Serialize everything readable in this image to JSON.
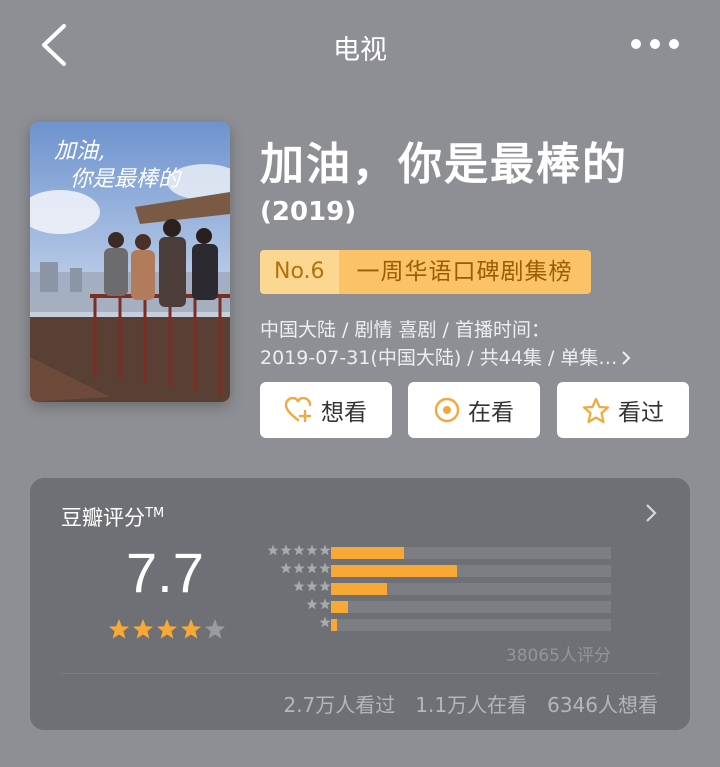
{
  "nav": {
    "title": "电视",
    "back_icon": "chevron-left-icon",
    "more_icon": "more-dots-icon"
  },
  "movie": {
    "title": "加油，你是最棒的",
    "year": "(2019)",
    "poster_title_art": "加油，你是最棒的",
    "rank": {
      "number": "No.6",
      "name": "一周华语口碑剧集榜"
    },
    "meta_line1": "中国大陆 / 剧情 喜剧 / 首播时间：",
    "meta_line2": "2019-07-31(中国大陆) / 共44集 / 单集…"
  },
  "actions": [
    {
      "label": "想看",
      "icon": "heart-plus-icon"
    },
    {
      "label": "在看",
      "icon": "circle-dot-icon"
    },
    {
      "label": "看过",
      "icon": "star-outline-icon"
    }
  ],
  "rating": {
    "title": "豆瓣评分",
    "trademark": "TM",
    "score": "7.7",
    "stars": 4,
    "distribution": [
      {
        "stars": 5,
        "fraction": 0.26
      },
      {
        "stars": 4,
        "fraction": 0.45
      },
      {
        "stars": 3,
        "fraction": 0.2
      },
      {
        "stars": 2,
        "fraction": 0.06
      },
      {
        "stars": 1,
        "fraction": 0.02
      }
    ],
    "count": "38065人评分",
    "watched": "2.7万人看过",
    "watching": "1.1万人在看",
    "want": "6346人想看"
  },
  "colors": {
    "background": "#8e8f94",
    "card": "#6f7075",
    "accent": "#f7a835",
    "rank_bg": "#fbc268"
  }
}
